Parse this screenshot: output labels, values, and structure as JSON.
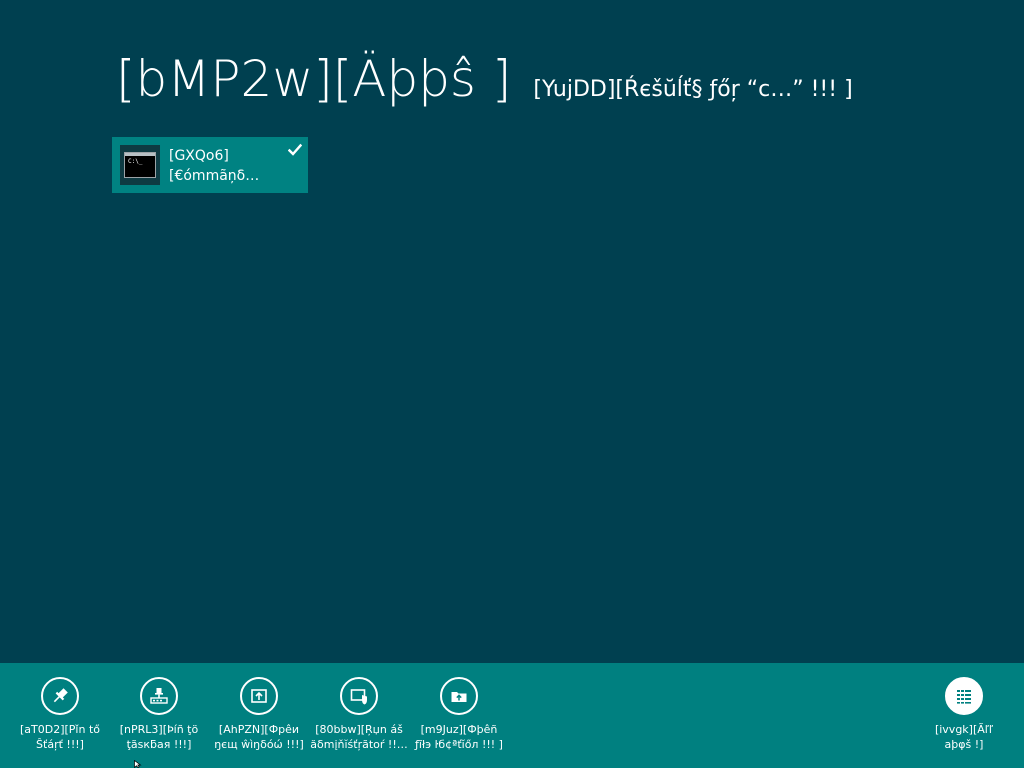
{
  "main": {
    "title": "[bMP2w][Äþþŝ ]",
    "results_label": "[YujDD][Ŕєšŭĺť§ ƒőŗ “c…” !!! ]",
    "results": [
      {
        "line1": "[GXQo6]",
        "line2": "[€ómmãņδ…",
        "icon": "command-prompt-icon",
        "icon_text": "C:\\_",
        "selected": true
      }
    ]
  },
  "app_bar": {
    "left_buttons": [
      {
        "icon": "pin-icon",
        "line1": "[aT0D2][Pǐn tő",
        "line2": "Ŝťáŗť !!!]"
      },
      {
        "icon": "taskbar-pin-icon",
        "line1": "[nPRL3][Þíñ ţö",
        "line2": "ţãѕкƃая !!!]"
      },
      {
        "icon": "open-window-icon",
        "line1": "[AhPZN][Фрêи",
        "line2": "ŋєщ ŵìŋδóώ !!!]"
      },
      {
        "icon": "run-as-admin-icon",
        "line1": "[80bbw][Ŗџn áš",
        "line2": "ăδmįňĭśťŗãtoŕ !!…"
      },
      {
        "icon": "open-file-location-icon",
        "line1": "[m9Juz][Фþêñ",
        "line2": "ƒĩłэ ŀб¢ªťĭőл !!! ]"
      }
    ],
    "right_buttons": [
      {
        "icon": "all-apps-icon",
        "line1": "[ivvgk][Ãľľ",
        "line2": "aþφš !]"
      }
    ]
  },
  "colors": {
    "background": "#004050",
    "app_bar": "#008080",
    "tile_selected": "#008282"
  }
}
